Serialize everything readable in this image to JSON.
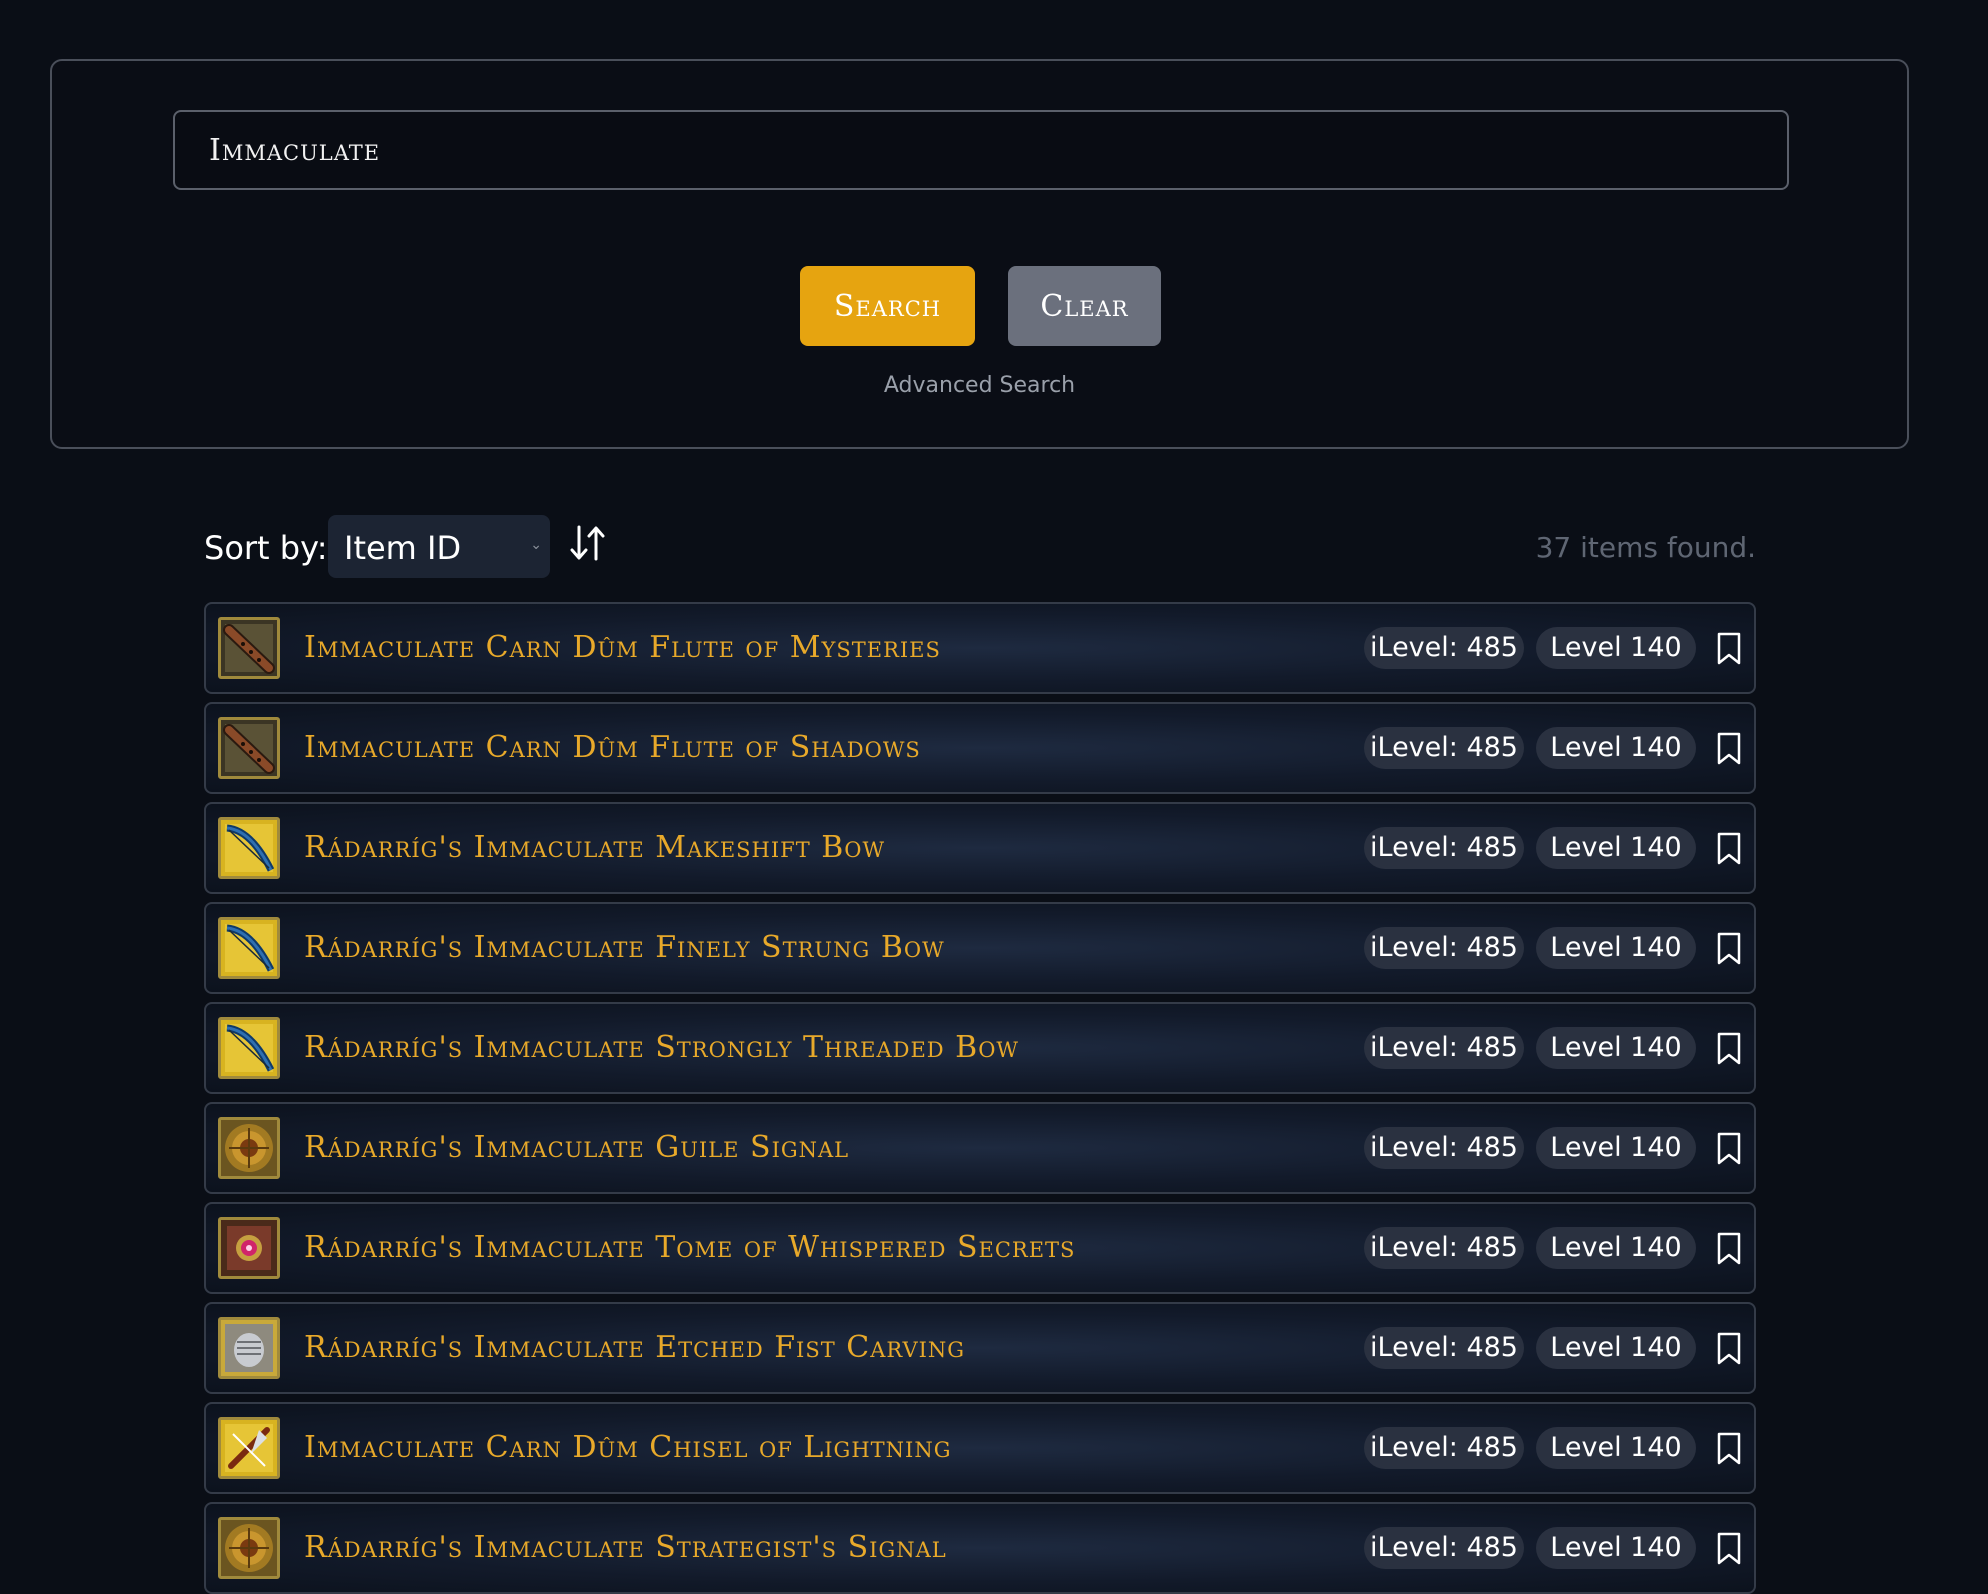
{
  "search": {
    "value": "Immaculate",
    "search_label": "Search",
    "clear_label": "Clear",
    "advanced_label": "Advanced Search"
  },
  "sort": {
    "label": "Sort by:",
    "selected": "Item ID",
    "direction_icon": "sort-direction-icon"
  },
  "results": {
    "count_text": "37 items found.",
    "items": [
      {
        "name": "Immaculate Carn Dûm Flute of Mysteries",
        "ilevel": "iLevel: 485",
        "level": "Level 140",
        "icon": "flute-icon"
      },
      {
        "name": "Immaculate Carn Dûm Flute of Shadows",
        "ilevel": "iLevel: 485",
        "level": "Level 140",
        "icon": "flute-icon"
      },
      {
        "name": "Rádarríg's Immaculate Makeshift Bow",
        "ilevel": "iLevel: 485",
        "level": "Level 140",
        "icon": "bow-icon"
      },
      {
        "name": "Rádarríg's Immaculate Finely Strung Bow",
        "ilevel": "iLevel: 485",
        "level": "Level 140",
        "icon": "bow-icon"
      },
      {
        "name": "Rádarríg's Immaculate Strongly Threaded Bow",
        "ilevel": "iLevel: 485",
        "level": "Level 140",
        "icon": "bow-icon"
      },
      {
        "name": "Rádarríg's Immaculate Guile Signal",
        "ilevel": "iLevel: 485",
        "level": "Level 140",
        "icon": "signal-icon"
      },
      {
        "name": "Rádarríg's Immaculate Tome of Whispered Secrets",
        "ilevel": "iLevel: 485",
        "level": "Level 140",
        "icon": "tome-icon"
      },
      {
        "name": "Rádarríg's Immaculate Etched Fist Carving",
        "ilevel": "iLevel: 485",
        "level": "Level 140",
        "icon": "fist-icon"
      },
      {
        "name": "Immaculate Carn Dûm Chisel of Lightning",
        "ilevel": "iLevel: 485",
        "level": "Level 140",
        "icon": "chisel-icon"
      },
      {
        "name": "Rádarríg's Immaculate Strategist's Signal",
        "ilevel": "iLevel: 485",
        "level": "Level 140",
        "icon": "signal-icon"
      }
    ]
  },
  "colors": {
    "background": "#0a0e16",
    "accent": "#e6a410",
    "item_name": "#e8a92a",
    "pill": "#2a3140",
    "clear_button": "#6b707d"
  }
}
